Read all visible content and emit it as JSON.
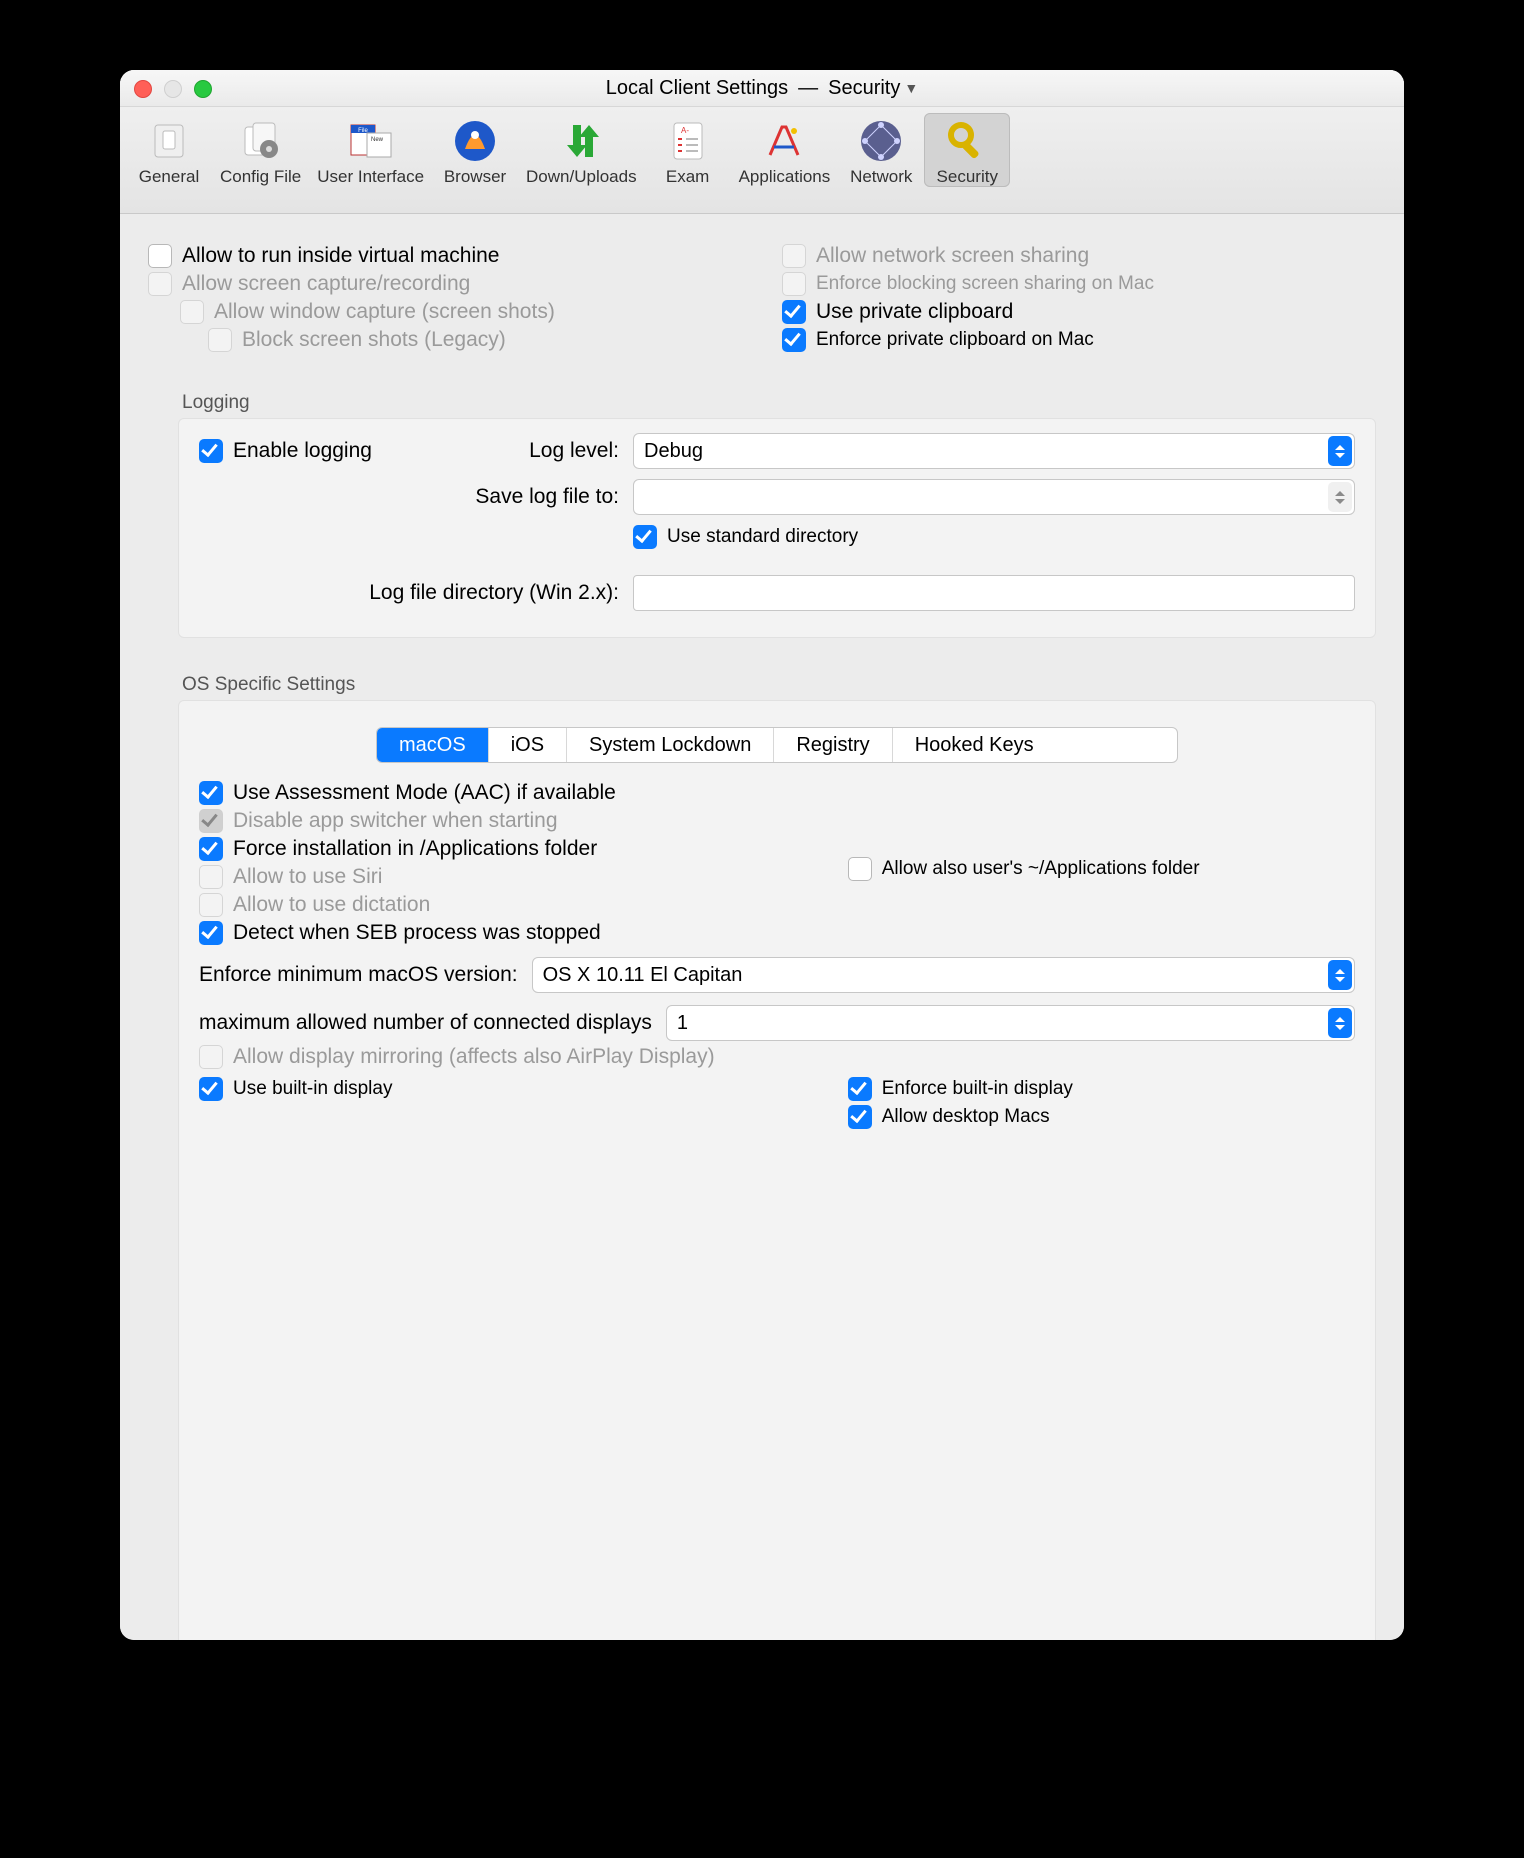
{
  "window": {
    "title_left": "Local Client Settings",
    "title_sep": "—",
    "title_right": "Security"
  },
  "toolbar": {
    "items": [
      {
        "label": "General"
      },
      {
        "label": "Config File"
      },
      {
        "label": "User Interface"
      },
      {
        "label": "Browser"
      },
      {
        "label": "Down/Uploads"
      },
      {
        "label": "Exam"
      },
      {
        "label": "Applications"
      },
      {
        "label": "Network"
      },
      {
        "label": "Security"
      }
    ],
    "selected_index": 8
  },
  "top_left": [
    {
      "label": "Allow to run inside virtual machine",
      "checked": false,
      "disabled": false,
      "indent": 0
    },
    {
      "label": "Allow screen capture/recording",
      "checked": false,
      "disabled": true,
      "indent": 0
    },
    {
      "label": "Allow window capture (screen shots)",
      "checked": false,
      "disabled": true,
      "indent": 1
    },
    {
      "label": "Block screen shots (Legacy)",
      "checked": false,
      "disabled": true,
      "indent": 2
    }
  ],
  "top_right": [
    {
      "label": "Allow network screen sharing",
      "checked": false,
      "disabled": true
    },
    {
      "label": "Enforce blocking screen sharing on Mac",
      "checked": false,
      "disabled": true,
      "small": true
    },
    {
      "label": "Use private clipboard",
      "checked": true,
      "disabled": false
    },
    {
      "label": "Enforce private clipboard on Mac",
      "checked": true,
      "disabled": false,
      "small": true
    }
  ],
  "logging": {
    "title": "Logging",
    "enable_label": "Enable logging",
    "enable_checked": true,
    "log_level_label": "Log level:",
    "log_level_value": "Debug",
    "save_to_label": "Save log file to:",
    "save_to_value": "",
    "use_std_label": "Use standard directory",
    "use_std_checked": true,
    "win_dir_label": "Log file directory (Win 2.x):",
    "win_dir_value": ""
  },
  "os": {
    "title": "OS Specific Settings",
    "tabs": [
      "macOS",
      "iOS",
      "System Lockdown",
      "Registry",
      "Hooked Keys"
    ],
    "selected_tab": 0,
    "left": [
      {
        "label": "Use Assessment Mode (AAC) if available",
        "checked": true,
        "disabled": false
      },
      {
        "label": "Disable app switcher when starting",
        "checked": true,
        "disabled": true
      },
      {
        "label": "Force installation in /Applications folder",
        "checked": true,
        "disabled": false
      },
      {
        "label": "Allow to use Siri",
        "checked": false,
        "disabled": true
      },
      {
        "label": "Allow to use dictation",
        "checked": false,
        "disabled": true
      },
      {
        "label": "Detect when SEB process was stopped",
        "checked": true,
        "disabled": false
      }
    ],
    "allow_user_apps": {
      "label": "Allow also user's ~/Applications folder",
      "checked": false
    },
    "min_version_label": "Enforce minimum macOS version:",
    "min_version_value": "OS X 10.11 El Capitan",
    "max_displays_label": "maximum allowed number of connected displays",
    "max_displays_value": "1",
    "mirror": {
      "label": "Allow display mirroring (affects also AirPlay Display)",
      "checked": false,
      "disabled": true
    },
    "bottom_left": {
      "label": "Use built-in display",
      "checked": true
    },
    "bottom_right": [
      {
        "label": "Enforce built-in display",
        "checked": true
      },
      {
        "label": "Allow desktop Macs",
        "checked": true
      }
    ]
  }
}
